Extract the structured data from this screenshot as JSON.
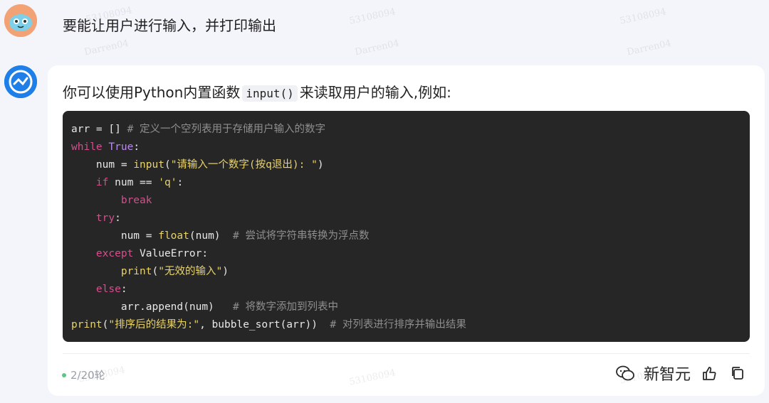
{
  "user_message": "要能让用户进行输入，并打印输出",
  "response": {
    "intro_before": "你可以使用Python内置函数",
    "intro_code": "input()",
    "intro_after": "来读取用户的输入,例如:",
    "code_lines": [
      [
        [
          "plain",
          "arr = [] "
        ],
        [
          "comment",
          "# 定义一个空列表用于存储用户输入的数字"
        ]
      ],
      [
        [
          "keyword",
          "while"
        ],
        [
          "plain",
          " "
        ],
        [
          "const",
          "True"
        ],
        [
          "plain",
          ":"
        ]
      ],
      [
        [
          "plain",
          "    num = "
        ],
        [
          "builtin",
          "input"
        ],
        [
          "plain",
          "("
        ],
        [
          "string",
          "\"请输入一个数字(按q退出): \""
        ],
        [
          "plain",
          ")"
        ]
      ],
      [
        [
          "plain",
          "    "
        ],
        [
          "keyword",
          "if"
        ],
        [
          "plain",
          " num == "
        ],
        [
          "string",
          "'q'"
        ],
        [
          "plain",
          ":"
        ]
      ],
      [
        [
          "plain",
          "        "
        ],
        [
          "keyword",
          "break"
        ]
      ],
      [
        [
          "plain",
          "    "
        ],
        [
          "keyword",
          "try"
        ],
        [
          "plain",
          ":"
        ]
      ],
      [
        [
          "plain",
          "        num = "
        ],
        [
          "builtin",
          "float"
        ],
        [
          "plain",
          "(num)  "
        ],
        [
          "comment",
          "# 尝试将字符串转换为浮点数"
        ]
      ],
      [
        [
          "plain",
          "    "
        ],
        [
          "keyword",
          "except"
        ],
        [
          "plain",
          " ValueError:"
        ]
      ],
      [
        [
          "plain",
          "        "
        ],
        [
          "builtin",
          "print"
        ],
        [
          "plain",
          "("
        ],
        [
          "string",
          "\"无效的输入\""
        ],
        [
          "plain",
          ")"
        ]
      ],
      [
        [
          "plain",
          "    "
        ],
        [
          "keyword",
          "else"
        ],
        [
          "plain",
          ":"
        ]
      ],
      [
        [
          "plain",
          "        arr.append(num)   "
        ],
        [
          "comment",
          "# 将数字添加到列表中"
        ]
      ],
      [
        [
          "builtin",
          "print"
        ],
        [
          "plain",
          "("
        ],
        [
          "string",
          "\"排序后的结果为:\""
        ],
        [
          "plain",
          ", bubble_sort(arr))  "
        ],
        [
          "comment",
          "# 对列表进行排序并输出结果"
        ]
      ]
    ]
  },
  "footer": {
    "round_label": "2/20轮",
    "brand_label": "新智元"
  },
  "watermarks": [
    "53108094",
    "Darren04"
  ],
  "icons": {
    "wechat": "wechat-icon",
    "thumbs_up": "thumbs-up-icon",
    "copy": "copy-icon",
    "user_avatar": "user-avatar",
    "bot_avatar": "bot-avatar"
  }
}
